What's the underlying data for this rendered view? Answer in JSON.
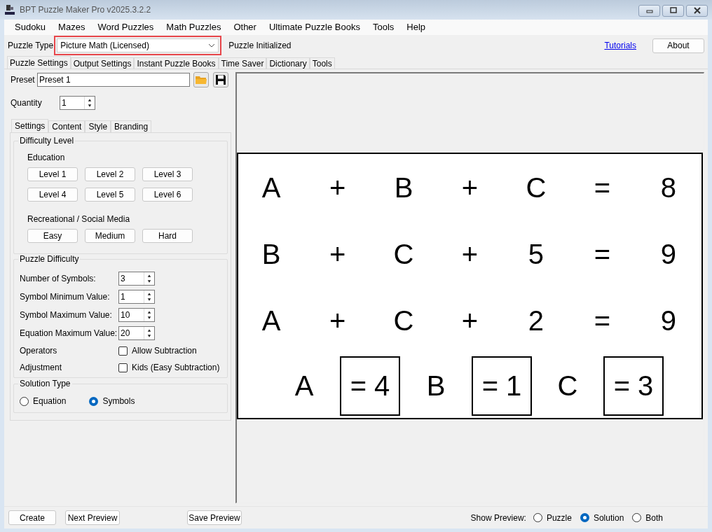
{
  "window": {
    "title": "BPT Puzzle Maker Pro v2025.3.2.2"
  },
  "menu": [
    "Sudoku",
    "Mazes",
    "Word Puzzles",
    "Math Puzzles",
    "Other",
    "Ultimate Puzzle Books",
    "Tools",
    "Help"
  ],
  "puzzle_type": {
    "label": "Puzzle Type",
    "value": "Picture Math (Licensed)",
    "highlighted": true
  },
  "status": "Puzzle Initialized",
  "tutorials_link": "Tutorials",
  "about_button": "About",
  "main_tabs": [
    {
      "label": "Puzzle Settings",
      "selected": true
    },
    {
      "label": "Output Settings",
      "selected": false
    },
    {
      "label": "Instant Puzzle Books",
      "selected": false
    },
    {
      "label": "Time Saver",
      "selected": false
    },
    {
      "label": "Dictionary",
      "selected": false
    },
    {
      "label": "Tools",
      "selected": false
    }
  ],
  "preset": {
    "label": "Preset",
    "value": "Preset 1"
  },
  "quantity": {
    "label": "Quantity",
    "value": "1"
  },
  "settings_tabs": [
    {
      "label": "Settings",
      "selected": true
    },
    {
      "label": "Content",
      "selected": false
    },
    {
      "label": "Style",
      "selected": false
    },
    {
      "label": "Branding",
      "selected": false
    }
  ],
  "difficulty_level": {
    "title": "Difficulty Level",
    "groups": [
      {
        "label": "Education",
        "buttons": [
          "Level 1",
          "Level 2",
          "Level 3",
          "Level 4",
          "Level 5",
          "Level 6"
        ]
      },
      {
        "label": "Recreational / Social Media",
        "buttons": [
          "Easy",
          "Medium",
          "Hard"
        ]
      }
    ]
  },
  "puzzle_difficulty": {
    "title": "Puzzle Difficulty",
    "spinners": [
      {
        "label": "Number of Symbols:",
        "value": "3"
      },
      {
        "label": "Symbol Minimum Value:",
        "value": "1"
      },
      {
        "label": "Symbol Maximum Value:",
        "value": "10"
      },
      {
        "label": "Equation Maximum Value:",
        "value": "20"
      }
    ],
    "checkboxes": [
      {
        "label": "Operators",
        "option": "Allow Subtraction",
        "checked": false
      },
      {
        "label": "Adjustment",
        "option": "Kids (Easy Subtraction)",
        "checked": false
      }
    ]
  },
  "solution_type": {
    "title": "Solution Type",
    "options": [
      {
        "label": "Equation",
        "selected": false
      },
      {
        "label": "Symbols",
        "selected": true
      }
    ]
  },
  "preview": {
    "equations": [
      [
        "A",
        "+",
        "B",
        "+",
        "C",
        "=",
        "8"
      ],
      [
        "B",
        "+",
        "C",
        "+",
        "5",
        "=",
        "9"
      ],
      [
        "A",
        "+",
        "C",
        "+",
        "2",
        "=",
        "9"
      ]
    ],
    "solutions": [
      {
        "symbol": "A",
        "value": "= 4"
      },
      {
        "symbol": "B",
        "value": "= 1"
      },
      {
        "symbol": "C",
        "value": "= 3"
      }
    ]
  },
  "bottom_buttons": [
    "Create",
    "Next Preview",
    "Save Preview"
  ],
  "show_preview": {
    "label": "Show Preview:",
    "options": [
      {
        "label": "Puzzle",
        "selected": false
      },
      {
        "label": "Solution",
        "selected": true
      },
      {
        "label": "Both",
        "selected": false
      }
    ]
  }
}
